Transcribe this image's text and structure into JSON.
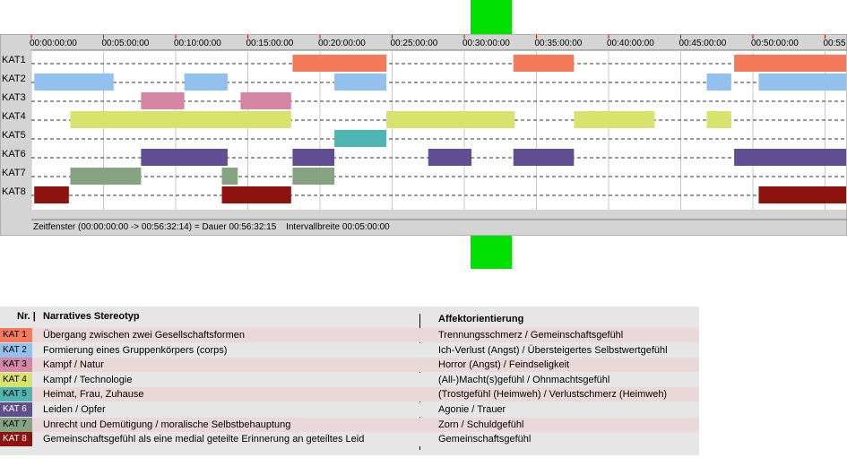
{
  "colors": {
    "KAT1": "#f47a5a",
    "KAT2": "#92c1ef",
    "KAT3": "#d685a4",
    "KAT4": "#d7e36c",
    "KAT5": "#4fb5b3",
    "KAT6": "#614e92",
    "KAT7": "#84a37f",
    "KAT8": "#8e120e"
  },
  "chart_data": {
    "type": "timeline",
    "x_unit": "minutes",
    "xlim": [
      0,
      56.54
    ],
    "ticks": [
      "00:00:00:00",
      "00:05:00:00",
      "00:10:00:00",
      "00:15:00:00",
      "00:20:00:00",
      "00:25:00:00",
      "00:30:00:00",
      "00:35:00:00",
      "00:40:00:00",
      "00:45:00:00",
      "00:50:00:00",
      "00:55"
    ],
    "grid": true,
    "categories": [
      "KAT1",
      "KAT2",
      "KAT3",
      "KAT4",
      "KAT5",
      "KAT6",
      "KAT7",
      "KAT8"
    ],
    "segments": [
      {
        "cat": "KAT1",
        "start": 18.1,
        "end": 24.6
      },
      {
        "cat": "KAT1",
        "start": 33.4,
        "end": 37.6
      },
      {
        "cat": "KAT1",
        "start": 48.7,
        "end": 56.6
      },
      {
        "cat": "KAT2",
        "start": 0.2,
        "end": 5.7
      },
      {
        "cat": "KAT2",
        "start": 10.6,
        "end": 13.6
      },
      {
        "cat": "KAT2",
        "start": 21.0,
        "end": 24.6
      },
      {
        "cat": "KAT2",
        "start": 46.8,
        "end": 48.5
      },
      {
        "cat": "KAT2",
        "start": 50.4,
        "end": 56.6
      },
      {
        "cat": "KAT3",
        "start": 7.6,
        "end": 10.6
      },
      {
        "cat": "KAT3",
        "start": 14.5,
        "end": 18.0
      },
      {
        "cat": "KAT4",
        "start": 2.7,
        "end": 18.0
      },
      {
        "cat": "KAT4",
        "start": 24.6,
        "end": 33.5
      },
      {
        "cat": "KAT4",
        "start": 37.6,
        "end": 43.2
      },
      {
        "cat": "KAT4",
        "start": 46.8,
        "end": 48.5
      },
      {
        "cat": "KAT5",
        "start": 21.0,
        "end": 24.6
      },
      {
        "cat": "KAT6",
        "start": 7.6,
        "end": 13.6
      },
      {
        "cat": "KAT6",
        "start": 18.1,
        "end": 21.0
      },
      {
        "cat": "KAT6",
        "start": 27.5,
        "end": 30.5
      },
      {
        "cat": "KAT6",
        "start": 33.4,
        "end": 37.6
      },
      {
        "cat": "KAT6",
        "start": 48.7,
        "end": 56.6
      },
      {
        "cat": "KAT7",
        "start": 2.7,
        "end": 7.6
      },
      {
        "cat": "KAT7",
        "start": 13.2,
        "end": 14.3
      },
      {
        "cat": "KAT7",
        "start": 18.1,
        "end": 21.0
      },
      {
        "cat": "KAT8",
        "start": 0.2,
        "end": 2.6
      },
      {
        "cat": "KAT8",
        "start": 13.2,
        "end": 18.0
      },
      {
        "cat": "KAT8",
        "start": 50.4,
        "end": 56.6
      }
    ]
  },
  "status": {
    "window": "Zeitfenster (00:00:00:00 -> 00:56:32:14) = Dauer 00:56:32:15",
    "interval": "Intervallbreite 00:05:00:00"
  },
  "legend": {
    "headers": {
      "nr": "Nr. |",
      "stereotyp": "Narratives Stereotyp",
      "affekt": "Affektorientierung"
    },
    "rows": [
      {
        "badge": "KAT 1",
        "color": "#f47a5a",
        "text": "#000000",
        "stereotyp": "Übergang zwischen zwei Gesellschaftsformen",
        "affekt": "Trennungsschmerz / Gemeinschaftsgefühl"
      },
      {
        "badge": "KAT 2",
        "color": "#92c1ef",
        "text": "#000000",
        "stereotyp": "Formierung eines Gruppenkörpers (corps)",
        "affekt": "Ich-Verlust (Angst) / Übersteigertes Selbstwertgefühl"
      },
      {
        "badge": "KAT 3",
        "color": "#d685a4",
        "text": "#000000",
        "stereotyp": "Kampf / Natur",
        "affekt": "Horror (Angst) / Feindseligkeit"
      },
      {
        "badge": "KAT 4",
        "color": "#d7e36c",
        "text": "#000000",
        "stereotyp": "Kampf / Technologie",
        "affekt": "(All-)Macht(s)gefühl / Ohnmachtsgefühl"
      },
      {
        "badge": "KAT 5",
        "color": "#4fb5b3",
        "text": "#000000",
        "stereotyp": "Heimat, Frau, Zuhause",
        "affekt": "(Trostgefühl (Heimweh) / Verlustschmerz (Heimweh)"
      },
      {
        "badge": "KAT 6",
        "color": "#614e92",
        "text": "#ffffff",
        "stereotyp": "Leiden / Opfer",
        "affekt": "Agonie / Trauer"
      },
      {
        "badge": "KAT 7",
        "color": "#84a37f",
        "text": "#000000",
        "stereotyp": "Unrecht und Demütigung / moralische Selbstbehauptung",
        "affekt": "Zorn / Schuldgefühl"
      },
      {
        "badge": "KAT 8",
        "color": "#8e120e",
        "text": "#ffffff",
        "stereotyp": "Gemeinschaftsgefühl als eine medial geteilte Erinnerung an geteiltes Leid",
        "affekt": "Gemeinschaftsgefühl"
      }
    ]
  }
}
